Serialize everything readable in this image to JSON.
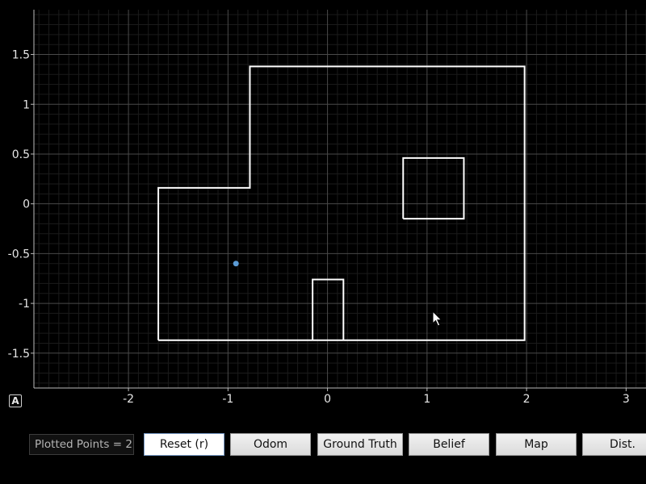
{
  "plot": {
    "background": "#000000",
    "grid_color": "#2a2a2a",
    "axis_color": "#bbbbbb",
    "map_color": "#ffffff",
    "point_color": "#5b9bd5",
    "x_ticks": [
      "-2",
      "-1",
      "0",
      "1",
      "2",
      "3"
    ],
    "y_ticks": [
      "1.5",
      "1",
      "0.5",
      "0",
      "-0.5",
      "-1",
      "-1.5"
    ],
    "x_range": [
      -2.95,
      3.2
    ],
    "y_range": [
      -1.85,
      1.95
    ],
    "walls": [
      [
        [
          -1.7,
          -1.37
        ],
        [
          -1.7,
          0.16
        ],
        [
          -0.78,
          0.16
        ],
        [
          -0.78,
          1.38
        ],
        [
          1.98,
          1.38
        ],
        [
          1.98,
          -1.37
        ],
        [
          -1.7,
          -1.37
        ]
      ],
      [
        [
          0.76,
          -0.15
        ],
        [
          0.76,
          0.46
        ],
        [
          1.37,
          0.46
        ],
        [
          1.37,
          -0.15
        ],
        [
          0.76,
          -0.15
        ]
      ],
      [
        [
          -0.15,
          -1.37
        ],
        [
          -0.15,
          -0.76
        ],
        [
          0.16,
          -0.76
        ],
        [
          0.16,
          -1.37
        ]
      ]
    ],
    "points": [
      {
        "x": -0.92,
        "y": -0.6
      }
    ]
  },
  "auto_button": "A",
  "status": {
    "text": "Plotted Points = 2"
  },
  "buttons": [
    {
      "label": "Reset (r)"
    },
    {
      "label": "Odom"
    },
    {
      "label": "Ground Truth"
    },
    {
      "label": "Belief"
    },
    {
      "label": "Map"
    },
    {
      "label": "Dist."
    }
  ]
}
